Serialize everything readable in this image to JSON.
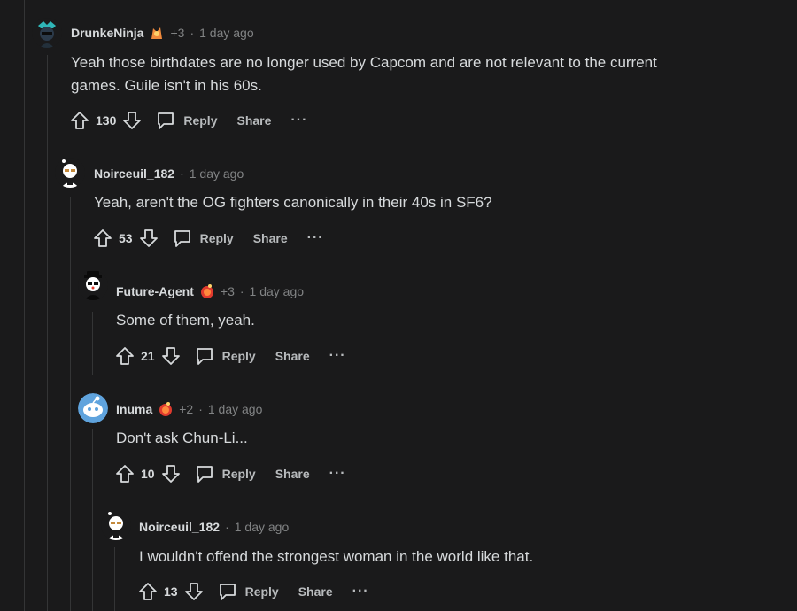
{
  "comments": [
    {
      "username": "DrunkeNinja",
      "flair_count": "+3",
      "separator": "·",
      "time": "1 day ago",
      "lines": [
        "Yeah those birthdates are no longer used by Capcom and are not relevant to the current",
        "games. Guile isn't in his 60s."
      ],
      "score": "130",
      "reply": "Reply",
      "share": "Share",
      "more": "···"
    },
    {
      "username": "Noirceuil_182",
      "separator": "·",
      "time": "1 day ago",
      "lines": [
        "Yeah, aren't the OG fighters canonically in their 40s in SF6?"
      ],
      "score": "53",
      "reply": "Reply",
      "share": "Share",
      "more": "···"
    },
    {
      "username": "Future-Agent",
      "flair_count": "+3",
      "separator": "·",
      "time": "1 day ago",
      "lines": [
        "Some of them, yeah."
      ],
      "score": "21",
      "reply": "Reply",
      "share": "Share",
      "more": "···"
    },
    {
      "username": "Inuma",
      "flair_count": "+2",
      "separator": "·",
      "time": "1 day ago",
      "lines": [
        "Don't ask Chun-Li..."
      ],
      "score": "10",
      "reply": "Reply",
      "share": "Share",
      "more": "···"
    },
    {
      "username": "Noirceuil_182",
      "separator": "·",
      "time": "1 day ago",
      "lines": [
        "I wouldn't offend the strongest woman in the world like that."
      ],
      "score": "13",
      "reply": "Reply",
      "share": "Share",
      "more": "···"
    }
  ],
  "colors": {
    "background": "#1a1a1b",
    "text": "#d7dadc",
    "meta": "#818384",
    "thread_line": "#343536"
  },
  "icons": {
    "upvote": "arrow-up-icon",
    "downvote": "arrow-down-icon",
    "reply": "speech-bubble-icon",
    "flair_drunkeninja": "ryu-flair-icon",
    "flair_fire": "fire-gem-flair-icon"
  }
}
